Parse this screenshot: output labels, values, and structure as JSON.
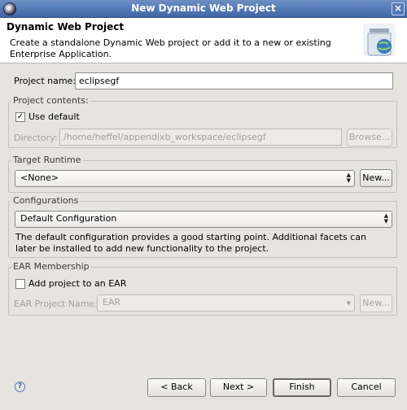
{
  "window": {
    "title": "New Dynamic Web Project"
  },
  "header": {
    "title": "Dynamic Web Project",
    "description": "Create a standalone Dynamic Web project or add it to a new or existing Enterprise Application."
  },
  "project_name": {
    "label": "Project name:",
    "value": "eclipsegf"
  },
  "project_contents": {
    "group_title": "Project contents:",
    "use_default_label": "Use default",
    "use_default_checked": true,
    "directory_label": "Directory:",
    "directory_value": "/home/heffel/appendixb_workspace/eclipsegf",
    "browse_label": "Browse..."
  },
  "target_runtime": {
    "group_title": "Target Runtime",
    "value": "<None>",
    "new_label": "New..."
  },
  "configurations": {
    "group_title": "Configurations",
    "value": "Default Configuration",
    "description": "The default configuration provides a good starting point. Additional facets can later be installed to add new functionality to the project."
  },
  "ear_membership": {
    "group_title": "EAR Membership",
    "add_label": "Add project to an EAR",
    "add_checked": false,
    "ear_project_label": "EAR Project Name:",
    "ear_project_value": "EAR",
    "new_label": "New..."
  },
  "footer": {
    "back_label": "< Back",
    "next_label": "Next >",
    "finish_label": "Finish",
    "cancel_label": "Cancel",
    "help_glyph": "?"
  }
}
